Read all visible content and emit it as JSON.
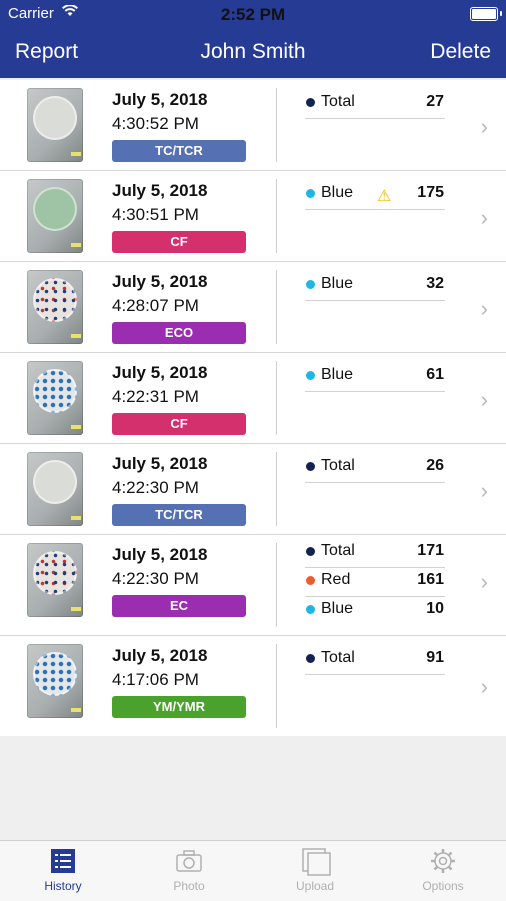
{
  "status": {
    "carrier": "Carrier",
    "time": "2:52 PM"
  },
  "nav": {
    "left": "Report",
    "title": "John  Smith",
    "right": "Delete"
  },
  "colors": {
    "header": "#263b94",
    "tc_tcr": "#5570b3",
    "cf": "#d4306d",
    "eco": "#9b2db0",
    "ec": "#9b2db0",
    "ym_ymr": "#4aa12c",
    "total_dot": "#142252",
    "blue_dot": "#1fb7e2",
    "red_dot": "#f15b2b"
  },
  "records": [
    {
      "date": "July 5, 2018",
      "time": "4:30:52 PM",
      "badge": "TC/TCR",
      "counts": [
        {
          "label": "Total",
          "value": "27"
        }
      ]
    },
    {
      "date": "July 5, 2018",
      "time": "4:30:51 PM",
      "badge": "CF",
      "counts": [
        {
          "label": "Blue",
          "value": "175",
          "warning": "⚠"
        }
      ]
    },
    {
      "date": "July 5, 2018",
      "time": "4:28:07 PM",
      "badge": "ECO",
      "counts": [
        {
          "label": "Blue",
          "value": "32"
        }
      ]
    },
    {
      "date": "July 5, 2018",
      "time": "4:22:31 PM",
      "badge": "CF",
      "counts": [
        {
          "label": "Blue",
          "value": "61"
        }
      ]
    },
    {
      "date": "July 5, 2018",
      "time": "4:22:30 PM",
      "badge": "TC/TCR",
      "counts": [
        {
          "label": "Total",
          "value": "26"
        }
      ]
    },
    {
      "date": "July 5, 2018",
      "time": "4:22:30 PM",
      "badge": "EC",
      "counts": [
        {
          "label": "Total",
          "value": "171"
        },
        {
          "label": "Red",
          "value": "161"
        },
        {
          "label": "Blue",
          "value": "10"
        }
      ]
    },
    {
      "date": "July 5, 2018",
      "time": "4:17:06 PM",
      "badge": "YM/YMR",
      "counts": [
        {
          "label": "Total",
          "value": "91"
        }
      ]
    }
  ],
  "tabs": [
    {
      "label": "History",
      "icon": "list-icon"
    },
    {
      "label": "Photo",
      "icon": "camera-icon"
    },
    {
      "label": "Upload",
      "icon": "upload-icon"
    },
    {
      "label": "Options",
      "icon": "gear-icon"
    }
  ]
}
